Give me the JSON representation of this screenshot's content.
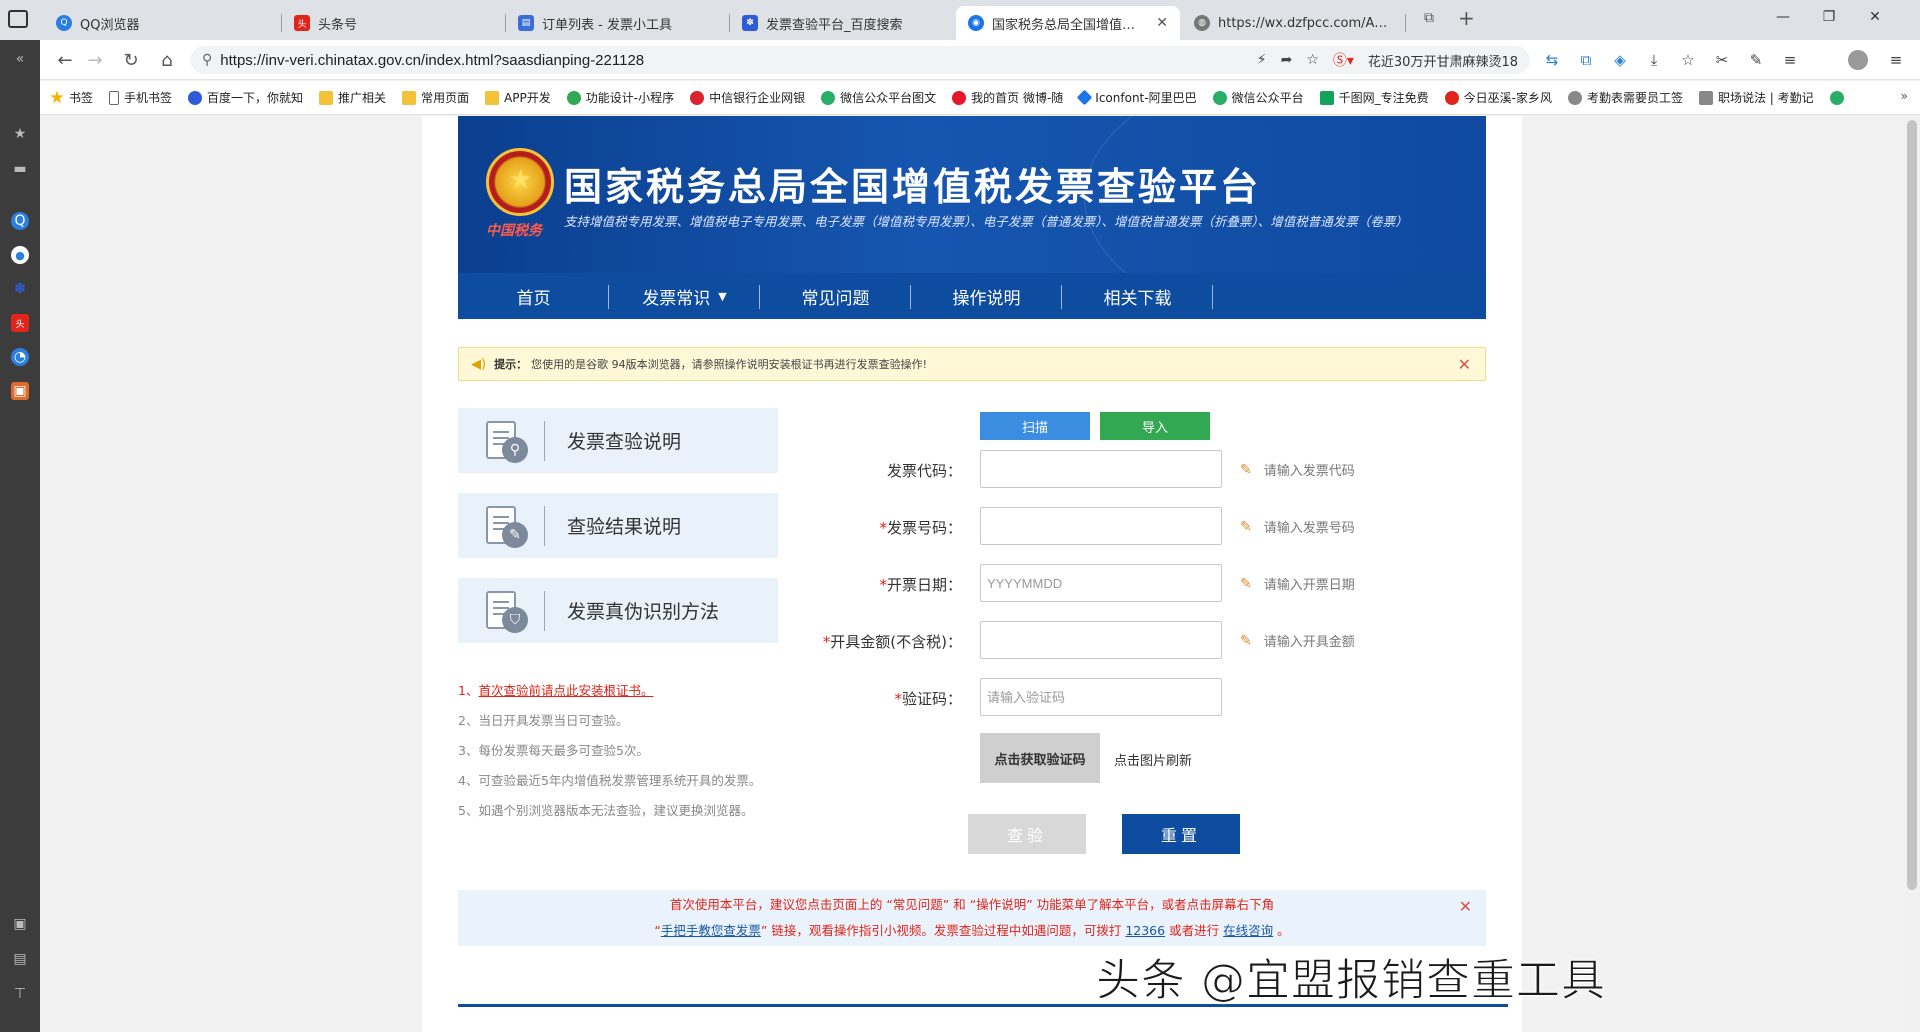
{
  "tabs": [
    {
      "label": "QQ浏览器",
      "favicon_color": "#2a7fe0",
      "active": false
    },
    {
      "label": "头条号",
      "favicon_color": "#e1251b",
      "active": false
    },
    {
      "label": "订单列表 - 发票小工具",
      "favicon_color": "#3a6fd8",
      "active": false
    },
    {
      "label": "发票查验平台_百度搜索",
      "favicon_color": "#2f5bd9",
      "active": false
    },
    {
      "label": "国家税务总局全国增值税发票查",
      "favicon_color": "#1a73e8",
      "active": true
    },
    {
      "label": "https://wx.dzfpcc.com/Accoun",
      "favicon_color": "#777777",
      "active": false
    }
  ],
  "address": {
    "url": "https://inv-veri.chinatax.gov.cn/index.html?saasdianping-221128",
    "news": "花近30万开甘肃麻辣烫18"
  },
  "bookmarks": [
    {
      "label": "书签",
      "color": "#f6b400"
    },
    {
      "label": "手机书签",
      "color": "#666666"
    },
    {
      "label": "百度一下，你就知",
      "color": "#2f5bd9"
    },
    {
      "label": "推广相关",
      "color": "#f3c13a"
    },
    {
      "label": "常用页面",
      "color": "#f3c13a"
    },
    {
      "label": "APP开发",
      "color": "#f3c13a"
    },
    {
      "label": "功能设计-小程序",
      "color": "#33a852"
    },
    {
      "label": "中信银行企业网银",
      "color": "#d9232d"
    },
    {
      "label": "微信公众平台图文",
      "color": "#2aae67"
    },
    {
      "label": "我的首页 微博-随",
      "color": "#e6162d"
    },
    {
      "label": "Iconfont-阿里巴巴",
      "color": "#1b74e8"
    },
    {
      "label": "微信公众平台",
      "color": "#2aae67"
    },
    {
      "label": "千图网_专注免费",
      "color": "#12a35a"
    },
    {
      "label": "今日巫溪-家乡风",
      "color": "#e1251b"
    },
    {
      "label": "考勤表需要员工签",
      "color": "#888888"
    },
    {
      "label": "职场说法 | 考勤记",
      "color": "#888888"
    }
  ],
  "banner": {
    "title": "国家税务总局全国增值税发票查验平台",
    "subtitle": "支持增值税专用发票、增值税电子专用发票、电子发票（增值税专用发票）、电子发票（普通发票）、增值税普通发票（折叠票）、增值税普通发票（卷票）",
    "seal_text": "中国税务"
  },
  "nav": [
    {
      "label": "首页"
    },
    {
      "label": "发票常识",
      "has_dropdown": true
    },
    {
      "label": "常见问题"
    },
    {
      "label": "操作说明"
    },
    {
      "label": "相关下载"
    }
  ],
  "notice": {
    "prefix": "提示：",
    "text": "您使用的是谷歌 94版本浏览器，请参照操作说明安装根证书再进行发票查验操作!"
  },
  "cards": [
    {
      "label": "发票查验说明",
      "icon": "magnifier-icon"
    },
    {
      "label": "查验结果说明",
      "icon": "pencil-icon"
    },
    {
      "label": "发票真伪识别方法",
      "icon": "shield-icon"
    }
  ],
  "tips": [
    {
      "num": "1、",
      "text": "首次查验前请点此安装根证书。"
    },
    {
      "num": "2、",
      "text": "当日开具发票当日可查验。"
    },
    {
      "num": "3、",
      "text": "每份发票每天最多可查验5次。"
    },
    {
      "num": "4、",
      "text": "可查验最近5年内增值税发票管理系统开具的发票。"
    },
    {
      "num": "5、",
      "text": "如遇个别浏览器版本无法查验，建议更换浏览器。"
    }
  ],
  "form": {
    "scan_label": "扫描",
    "import_label": "导入",
    "fields": [
      {
        "label": "发票代码：",
        "required": false,
        "value": "",
        "placeholder": "",
        "hint": "请输入发票代码"
      },
      {
        "label": "发票号码：",
        "required": true,
        "value": "",
        "placeholder": "",
        "hint": "请输入发票号码"
      },
      {
        "label": "开票日期：",
        "required": true,
        "value": "",
        "placeholder": "YYYYMMDD",
        "hint": "请输入开票日期"
      },
      {
        "label": "开具金额(不含税)：",
        "required": true,
        "value": "",
        "placeholder": "",
        "hint": "请输入开具金额"
      },
      {
        "label": "验证码：",
        "required": true,
        "value": "",
        "placeholder": "请输入验证码",
        "hint": ""
      }
    ],
    "captcha_text": "点击获取验证码",
    "captcha_hint": "点击图片刷新",
    "query_label": "查验",
    "reset_label": "重置"
  },
  "info": {
    "line1": "首次使用本平台，建议您点击页面上的 “常见问题” 和 “操作说明” 功能菜单了解本平台，或者点击屏幕右下角",
    "link_guide": "手把手教您查发票",
    "line2_mid": "” 链接，观看操作指引小视频。发票查验过程中如遇问题，可拨打",
    "phone": "12366",
    "line2_or": "或者进行",
    "link_consult": "在线咨询",
    "line2_end": "。"
  },
  "watermark": "头条 @宜盟报销查重工具",
  "colors": {
    "brand_blue": "#0d4c9e",
    "scan_blue": "#3a8de0",
    "import_green": "#32a852",
    "alert_red": "#e1251b"
  }
}
